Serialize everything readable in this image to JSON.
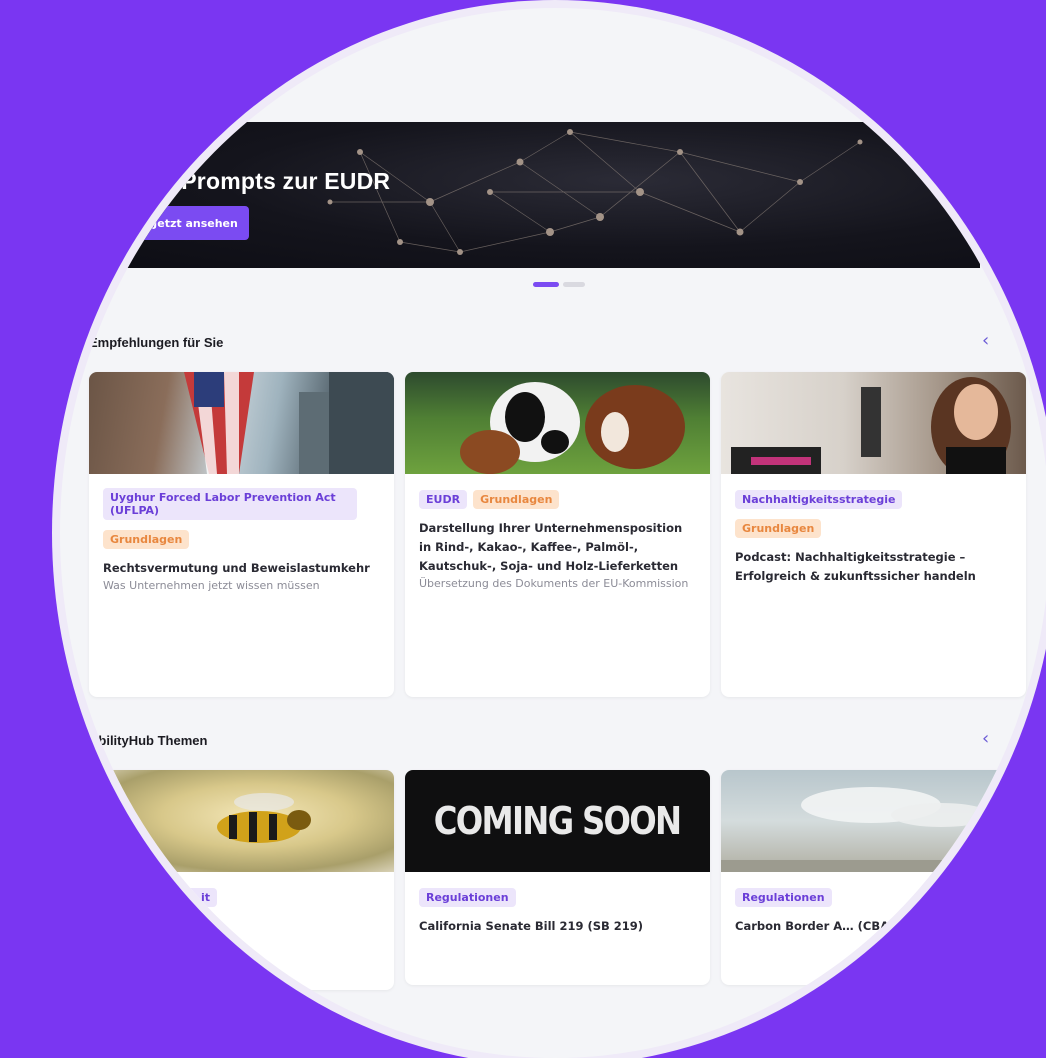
{
  "hero": {
    "title": "KI-Prompts zur EUDR",
    "button_label": "Jetzt ansehen"
  },
  "carousel": {
    "slides": 2,
    "active": 1
  },
  "recommendations": {
    "title": "Empfehlungen für Sie",
    "cards": [
      {
        "tags": [
          "Uyghur Forced Labor Prevention Act (UFLPA)"
        ],
        "tags2": [
          "Grundlagen"
        ],
        "title": "Rechtsvermutung und Beweislastumkehr",
        "subtitle": "Was Unternehmen jetzt wissen müssen"
      },
      {
        "tags": [
          "EUDR"
        ],
        "tags_orange": [
          "Grundlagen"
        ],
        "title": "Darstellung Ihrer Unternehmensposition in Rind-, Kakao-, Kaffee-, Palmöl-, Kautschuk-, Soja- und Holz-Lieferketten",
        "subtitle": "Übersetzung des Dokuments der EU-Kommission"
      },
      {
        "tags": [
          "Nachhaltigkeitsstrategie"
        ],
        "tags2": [
          "Grundlagen"
        ],
        "title": "Podcast: Nachhaltigkeitsstrategie – Erfolgreich & zukunftssicher handeln",
        "subtitle": ""
      }
    ]
  },
  "themes": {
    "title": "AbilityHub Themen",
    "cards": [
      {
        "tag": "…it",
        "title": ""
      },
      {
        "tag": "Regulationen",
        "title": "California Senate Bill 219 (SB 219)",
        "image_text": "COMING SOON"
      },
      {
        "tag": "Regulationen",
        "title": "Carbon Border A… (CBAM)"
      }
    ]
  },
  "colors": {
    "accent": "#7b4bf2",
    "background": "#7a36f2",
    "tag_purple": "#ece5fb",
    "tag_orange": "#fde3cc"
  }
}
